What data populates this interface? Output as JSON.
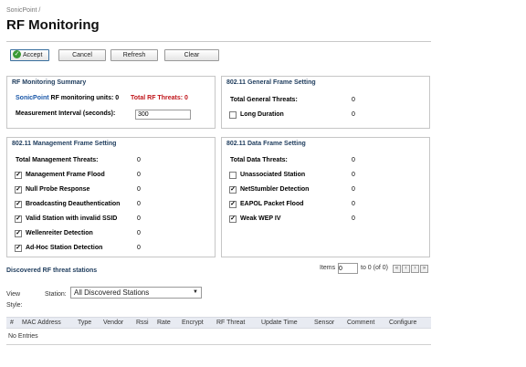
{
  "breadcrumb": "SonicPoint /",
  "page_title": "RF Monitoring",
  "toolbar": {
    "accept": "Accept",
    "cancel": "Cancel",
    "refresh": "Refresh",
    "clear": "Clear"
  },
  "summary": {
    "title": "RF Monitoring Summary",
    "units_prefix": "SonicPoint",
    "units_label": "RF monitoring units:",
    "units_value": "0",
    "total_threats_label": "Total RF Threats:",
    "total_threats_value": "0",
    "interval_label": "Measurement Interval (seconds):",
    "interval_value": "300"
  },
  "general": {
    "title": "802.11 General Frame Setting",
    "total_label": "Total General Threats:",
    "total_value": "0",
    "items": [
      {
        "label": "Long Duration",
        "checked": false,
        "value": "0"
      }
    ]
  },
  "management": {
    "title": "802.11 Management Frame Setting",
    "total_label": "Total Management Threats:",
    "total_value": "0",
    "items": [
      {
        "label": "Management Frame Flood",
        "checked": true,
        "value": "0"
      },
      {
        "label": "Null Probe Response",
        "checked": true,
        "value": "0"
      },
      {
        "label": "Broadcasting Deauthentication",
        "checked": true,
        "value": "0"
      },
      {
        "label": "Valid Station with invalid SSID",
        "checked": true,
        "value": "0"
      },
      {
        "label": "Wellenreiter Detection",
        "checked": true,
        "value": "0"
      },
      {
        "label": "Ad-Hoc Station Detection",
        "checked": true,
        "value": "0"
      }
    ]
  },
  "data_frame": {
    "title": "802.11 Data Frame Setting",
    "total_label": "Total Data Threats:",
    "total_value": "0",
    "items": [
      {
        "label": "Unassociated Station",
        "checked": false,
        "value": "0"
      },
      {
        "label": "NetStumbler Detection",
        "checked": true,
        "value": "0"
      },
      {
        "label": "EAPOL Packet Flood",
        "checked": true,
        "value": "0"
      },
      {
        "label": "Weak WEP IV",
        "checked": true,
        "value": "0"
      }
    ]
  },
  "discovered": {
    "title": "Discovered RF threat stations",
    "items_label": "Items",
    "items_value": "0",
    "range": "to 0 (of 0)",
    "view_style_label": "View Style:",
    "station_label": "Station:",
    "station_selected": "All Discovered Stations",
    "columns": [
      "#",
      "MAC Address",
      "Type",
      "Vendor",
      "Rssi",
      "Rate",
      "Encrypt",
      "RF Threat",
      "Update Time",
      "Sensor",
      "Comment",
      "Configure"
    ],
    "empty_text": "No Entries"
  },
  "colors": {
    "heading": "#1d3b5c",
    "link_blue": "#1a57a8",
    "threat_red": "#c0151a",
    "accept_green": "#3b9a34"
  },
  "icons": {
    "accept": "checkmark-icon",
    "pager": [
      "first-page-icon",
      "prev-page-icon",
      "next-page-icon",
      "last-page-icon"
    ],
    "select": "chevron-down-icon"
  }
}
